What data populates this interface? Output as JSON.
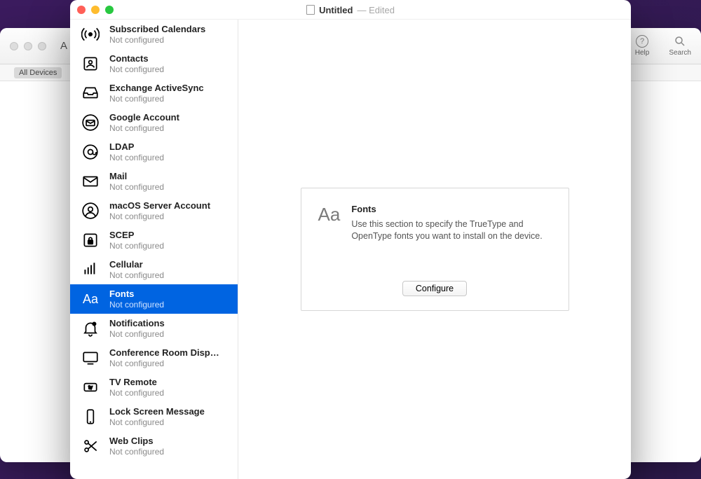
{
  "background_window": {
    "toolbar_title_letter": "A",
    "help_label": "Help",
    "search_label": "Search",
    "all_devices_chip": "All Devices"
  },
  "modal": {
    "title": "Untitled",
    "edited_suffix": "— Edited"
  },
  "sidebar": {
    "items": [
      {
        "id": "subscribed-calendars",
        "icon": "broadcast",
        "title": "Subscribed Calendars",
        "sub": "Not configured",
        "selected": false
      },
      {
        "id": "contacts",
        "icon": "contact",
        "title": "Contacts",
        "sub": "Not configured",
        "selected": false
      },
      {
        "id": "exchange-activesync",
        "icon": "tray",
        "title": "Exchange ActiveSync",
        "sub": "Not configured",
        "selected": false
      },
      {
        "id": "google-account",
        "icon": "envelope-circle",
        "title": "Google Account",
        "sub": "Not configured",
        "selected": false
      },
      {
        "id": "ldap",
        "icon": "at",
        "title": "LDAP",
        "sub": "Not configured",
        "selected": false
      },
      {
        "id": "mail",
        "icon": "envelope",
        "title": "Mail",
        "sub": "Not configured",
        "selected": false
      },
      {
        "id": "macos-server",
        "icon": "person-circle",
        "title": "macOS Server Account",
        "sub": "Not configured",
        "selected": false
      },
      {
        "id": "scep",
        "icon": "lock",
        "title": "SCEP",
        "sub": "Not configured",
        "selected": false
      },
      {
        "id": "cellular",
        "icon": "bars",
        "title": "Cellular",
        "sub": "Not configured",
        "selected": false
      },
      {
        "id": "fonts",
        "icon": "aa",
        "title": "Fonts",
        "sub": "Not configured",
        "selected": true
      },
      {
        "id": "notifications",
        "icon": "bell",
        "title": "Notifications",
        "sub": "Not configured",
        "selected": false
      },
      {
        "id": "conference-room",
        "icon": "display",
        "title": "Conference Room Display",
        "sub": "Not configured",
        "selected": false
      },
      {
        "id": "tv-remote",
        "icon": "appletv",
        "title": "TV Remote",
        "sub": "Not configured",
        "selected": false
      },
      {
        "id": "lock-screen",
        "icon": "phone",
        "title": "Lock Screen Message",
        "sub": "Not configured",
        "selected": false
      },
      {
        "id": "web-clips",
        "icon": "scissors",
        "title": "Web Clips",
        "sub": "Not configured",
        "selected": false
      }
    ]
  },
  "detail": {
    "icon_label": "Aa",
    "title": "Fonts",
    "description": "Use this section to specify the TrueType and OpenType fonts you want to install on the device.",
    "configure_button": "Configure"
  }
}
